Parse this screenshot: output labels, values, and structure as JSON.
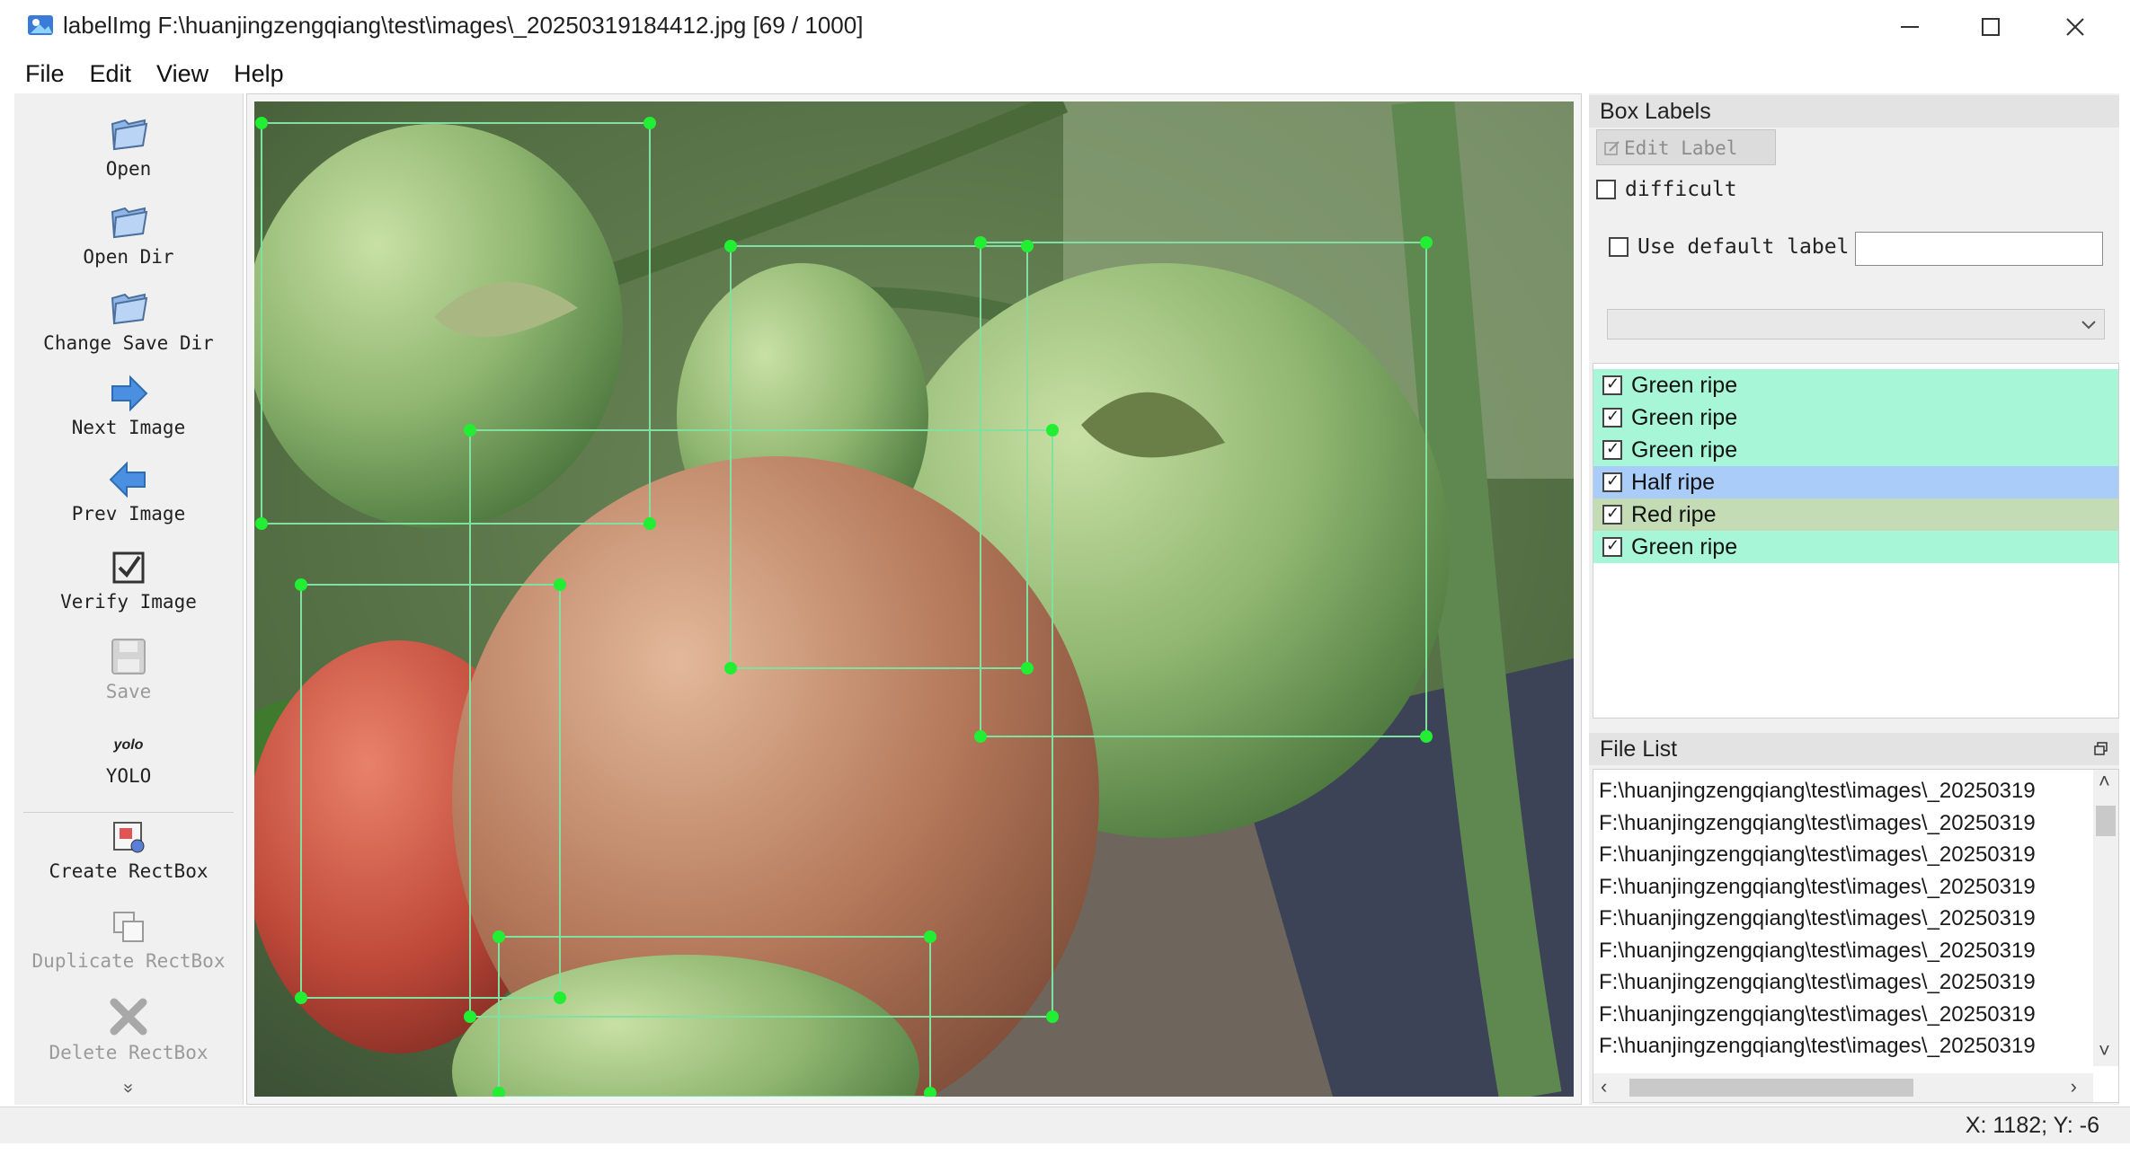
{
  "window": {
    "title": "labelImg F:\\huanjingzengqiang\\test\\images\\_20250319184412.jpg [69 / 1000]"
  },
  "menu": [
    "File",
    "Edit",
    "View",
    "Help"
  ],
  "toolbar": {
    "open": "Open",
    "open_dir": "Open Dir",
    "change_save_dir": "Change Save Dir",
    "next_image": "Next Image",
    "prev_image": "Prev Image",
    "verify_image": "Verify Image",
    "save": "Save",
    "yolo_icon_text": "yolo",
    "yolo": "YOLO",
    "create_rectbox": "Create RectBox",
    "duplicate_rectbox": "Duplicate RectBox",
    "delete_rectbox": "Delete RectBox",
    "more": "»"
  },
  "box_labels": {
    "title": "Box Labels",
    "edit_label": "Edit Label",
    "difficult": "difficult",
    "use_default_label": "Use default label",
    "default_label_value": "",
    "items": [
      {
        "label": "Green ripe",
        "checked": true,
        "color": "#a7f6d8"
      },
      {
        "label": "Green ripe",
        "checked": true,
        "color": "#a7f6d8"
      },
      {
        "label": "Green ripe",
        "checked": true,
        "color": "#a7f6d8"
      },
      {
        "label": "Half ripe",
        "checked": true,
        "color": "#a9cdf8"
      },
      {
        "label": "Red ripe",
        "checked": true,
        "color": "#c3dcb6"
      },
      {
        "label": "Green ripe",
        "checked": true,
        "color": "#a7f6d8"
      }
    ]
  },
  "file_list": {
    "title": "File List",
    "files": [
      "F:\\huanjingzengqiang\\test\\images\\_20250319",
      "F:\\huanjingzengqiang\\test\\images\\_20250319",
      "F:\\huanjingzengqiang\\test\\images\\_20250319",
      "F:\\huanjingzengqiang\\test\\images\\_20250319",
      "F:\\huanjingzengqiang\\test\\images\\_20250319",
      "F:\\huanjingzengqiang\\test\\images\\_20250319",
      "F:\\huanjingzengqiang\\test\\images\\_20250319",
      "F:\\huanjingzengqiang\\test\\images\\_20250319",
      "F:\\huanjingzengqiang\\test\\images\\_20250319"
    ]
  },
  "status": {
    "coords": "X: 1182; Y: -6"
  },
  "colors": {
    "box_outline": "#7fe0a0",
    "vertex": "#22ee33",
    "toolbar_bg": "#f0f0f0"
  }
}
